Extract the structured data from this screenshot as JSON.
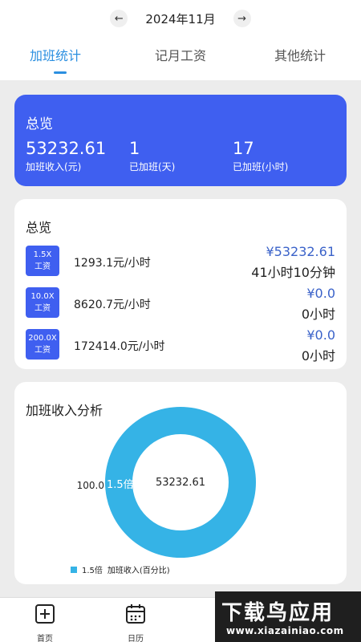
{
  "header": {
    "month": "2024年11月",
    "prev_icon": "arrow-left-icon",
    "next_icon": "arrow-right-icon"
  },
  "tabs": [
    {
      "label": "加班统计",
      "active": true
    },
    {
      "label": "记月工资",
      "active": false
    },
    {
      "label": "其他统计",
      "active": false
    }
  ],
  "summary": {
    "title": "总览",
    "stats": [
      {
        "value": "53232.61",
        "label": "加班收入(元)"
      },
      {
        "value": "1",
        "label": "已加班(天)"
      },
      {
        "value": "17",
        "label": "已加班(小时)"
      }
    ]
  },
  "rates": {
    "title": "总览",
    "items": [
      {
        "multiplier": "1.5X",
        "unit": "工资",
        "price": "1293.1元/小时",
        "amount": "¥53232.61",
        "time": "41小时10分钟"
      },
      {
        "multiplier": "10.0X",
        "unit": "工资",
        "price": "8620.7元/小时",
        "amount": "¥0.0",
        "time": "0小时"
      },
      {
        "multiplier": "200.0X",
        "unit": "工资",
        "price": "172414.0元/小时",
        "amount": "¥0.0",
        "time": "0小时"
      }
    ]
  },
  "analysis": {
    "title": "加班收入分析"
  },
  "chart_data": {
    "type": "pie",
    "categories": [
      "1.5倍"
    ],
    "values": [
      100.0
    ],
    "center_label": "53232.61",
    "slice_label": "1.5倍",
    "value_label": "100.0",
    "legend": [
      {
        "name": "1.5倍",
        "text": "加班收入(百分比)"
      }
    ],
    "colors": [
      "#35b3e6"
    ]
  },
  "bottom_nav": [
    {
      "label": "首页",
      "icon": "plus-square-icon"
    },
    {
      "label": "日历",
      "icon": "calendar-icon"
    }
  ],
  "watermark": {
    "title": "下载鸟应用",
    "url": "www.xiazainiao.com"
  }
}
